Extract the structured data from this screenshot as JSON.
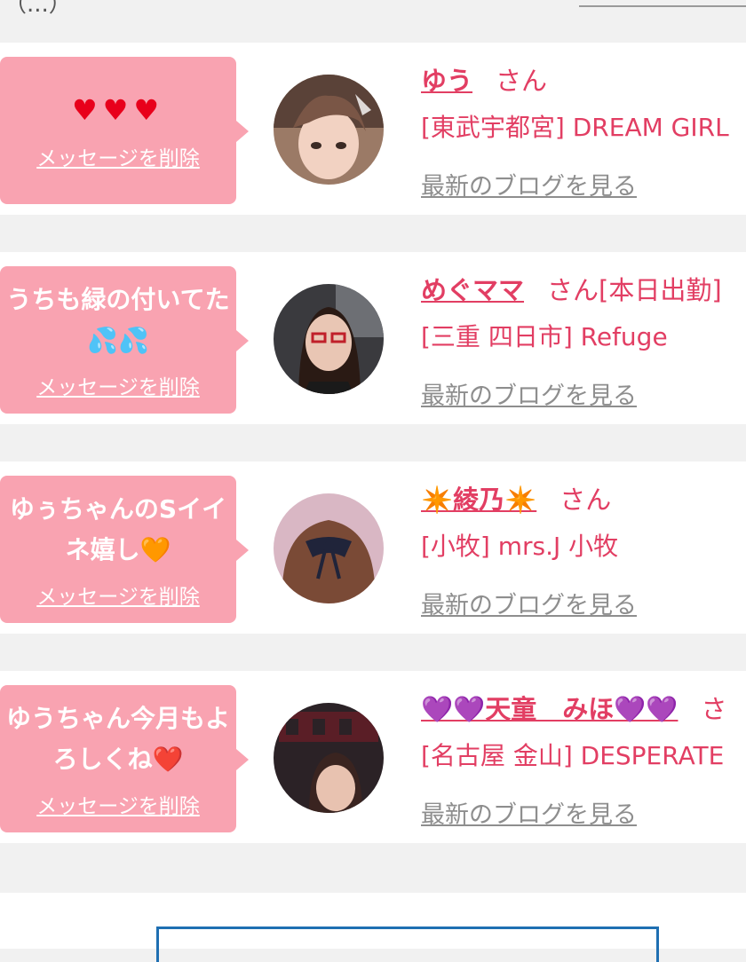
{
  "header": {
    "partial_text": "（...）"
  },
  "cards": [
    {
      "message_icons": [
        "heart-icon",
        "heart-icon",
        "heart-icon"
      ],
      "message": "",
      "delete_label": "メッセージを削除",
      "name": "ゆう",
      "honorific": "さん",
      "status": "",
      "shop": "[東武宇都宮] DREAM GIRL",
      "blog_label": "最新のブログを見る"
    },
    {
      "message": "うちも緑の付いてた💦💦",
      "delete_label": "メッセージを削除",
      "name": "めぐママ",
      "honorific": "さん",
      "status": "[本日出勤]",
      "shop": "[三重 四日市] Refuge",
      "blog_label": "最新のブログを見る"
    },
    {
      "message": "ゆぅちゃんのSイイネ嬉し🧡",
      "delete_label": "メッセージを削除",
      "name": "✴️綾乃✴️",
      "honorific": "さん",
      "status": "",
      "shop": "[小牧] mrs.J 小牧",
      "blog_label": "最新のブログを見る"
    },
    {
      "message": "ゆうちゃん今月もよろしくね❤️",
      "delete_label": "メッセージを削除",
      "name": "💜💜天童　みほ💜💜",
      "honorific": "さ",
      "status": "",
      "shop": "[名古屋 金山] DESPERATE",
      "blog_label": "最新のブログを見る"
    }
  ]
}
